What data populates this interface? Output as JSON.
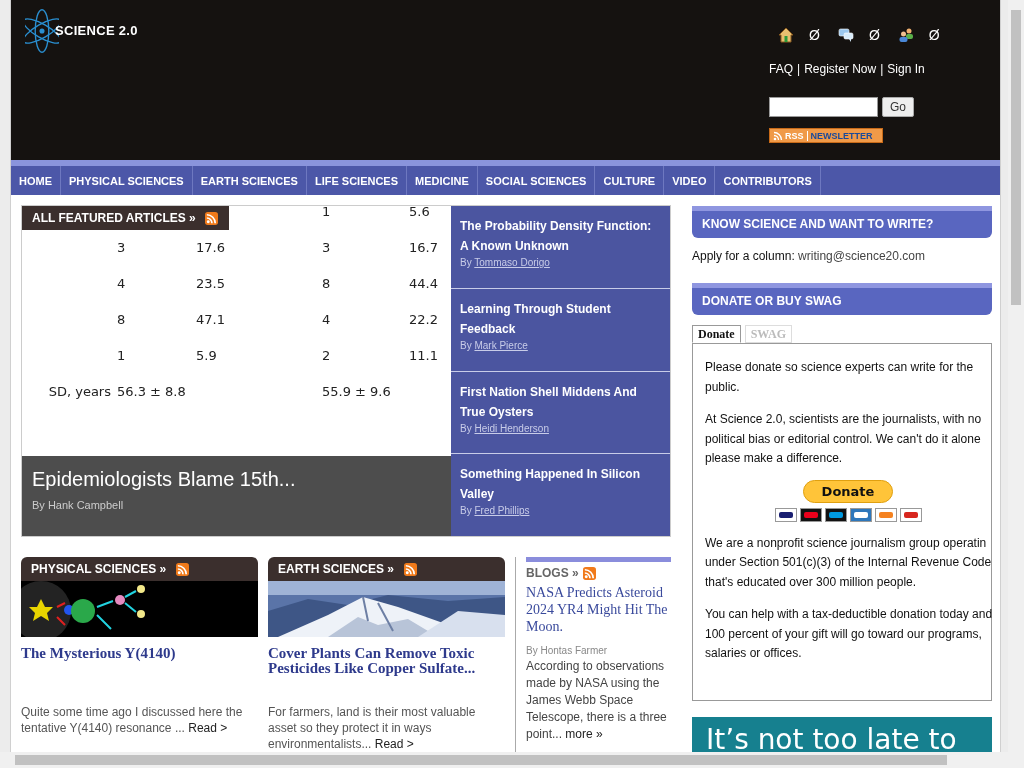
{
  "header": {
    "logo": "SCIENCE 2.0",
    "icons": [
      {
        "kind": "home",
        "count": "Ø"
      },
      {
        "kind": "chat",
        "count": "Ø"
      },
      {
        "kind": "people",
        "count": "Ø"
      }
    ],
    "links": [
      "FAQ",
      "Register Now",
      "Sign In"
    ],
    "link_separator": "|",
    "search": {
      "button": "Go"
    },
    "badge": {
      "rss": "RSS",
      "label": "NEWSLETTER"
    }
  },
  "nav": [
    {
      "label": "HOME"
    },
    {
      "label": "PHYSICAL SCIENCES"
    },
    {
      "label": "EARTH SCIENCES"
    },
    {
      "label": "LIFE SCIENCES"
    },
    {
      "label": "MEDICINE"
    },
    {
      "label": "SOCIAL SCIENCES"
    },
    {
      "label": "CULTURE"
    },
    {
      "label": "VIDEO"
    },
    {
      "label": "CONTRIBUTORS"
    }
  ],
  "featured": {
    "heading": "ALL FEATURED ARTICLES »",
    "figure_rows": [
      [
        null,
        null,
        null,
        "1",
        "5.6"
      ],
      [
        null,
        "3",
        "17.6",
        "3",
        "16.7"
      ],
      [
        null,
        "4",
        "23.5",
        "8",
        "44.4"
      ],
      [
        null,
        "8",
        "47.1",
        "4",
        "22.2"
      ],
      [
        null,
        "1",
        "5.9",
        "2",
        "11.1"
      ],
      [
        "SD, years",
        "56.3 ± 8.8",
        null,
        "55.9 ± 9.6",
        null
      ],
      [
        null,
        null,
        null,
        null,
        null
      ]
    ],
    "lead": {
      "title": "Epidemiologists Blame 15th...",
      "byline": "By Hank Campbell"
    },
    "articles": [
      {
        "title": "The Probability Density Function: A Known Unknown",
        "by": "By",
        "author": "Tommaso Dorigo"
      },
      {
        "title": "Learning Through Student Feedback",
        "by": "By",
        "author": "Mark Pierce"
      },
      {
        "title": "First Nation Shell Middens And True Oysters",
        "by": "By",
        "author": "Heidi Henderson"
      },
      {
        "title": "Something Happened In Silicon Valley",
        "by": "By",
        "author": "Fred Phillips"
      }
    ]
  },
  "sections": [
    {
      "heading": "PHYSICAL SCIENCES »",
      "kind": "particles",
      "title": "The Mysterious Y(4140)",
      "excerpt": "Quite some time ago I discussed here the tentative Y(4140) resonance ...",
      "more": "Read >"
    },
    {
      "heading": "EARTH SCIENCES »",
      "kind": "mountain",
      "title": "Cover Plants Can Remove Toxic Pesticides Like Copper Sulfate...",
      "excerpt": "For farmers, land is their most valuable asset so they protect it in ways environmentalists...",
      "more": "Read >"
    }
  ],
  "blogs": {
    "heading": "BLOGS »",
    "title": "NASA Predicts Asteroid 2024 YR4 Might Hit The Moon.",
    "byline": "By Hontas Farmer",
    "excerpt": "According to observations made by NASA using the James Webb Space Telescope, there is a three point...",
    "more": "more »"
  },
  "sidebar": {
    "write": {
      "heading": "KNOW SCIENCE AND WANT TO WRITE?",
      "label": "Apply for a column:",
      "email": "writing@science20.com"
    },
    "donate": {
      "heading": "DONATE OR BUY SWAG",
      "tabs": [
        {
          "label": "Donate",
          "selected": true
        },
        {
          "label": "SWAG",
          "selected": false
        }
      ],
      "paragraphs": [
        [
          "Please donate so science experts can write for the",
          "public."
        ],
        [
          "At Science 2.0, scientists are the journalists, with no",
          "political bias or editorial control. We can't do it alone",
          "please make a difference."
        ],
        [
          "We are a nonprofit science journalism group operatin",
          "under Section 501(c)(3) of the Internal Revenue Code",
          "that's educated over 300 million people."
        ],
        [
          "You can help with a tax-deductible donation today and",
          "100 percent of your gift will go toward our programs,",
          "salaries or offices."
        ]
      ],
      "button": "Donate"
    },
    "ad": {
      "text": "It’s not too late to"
    }
  }
}
